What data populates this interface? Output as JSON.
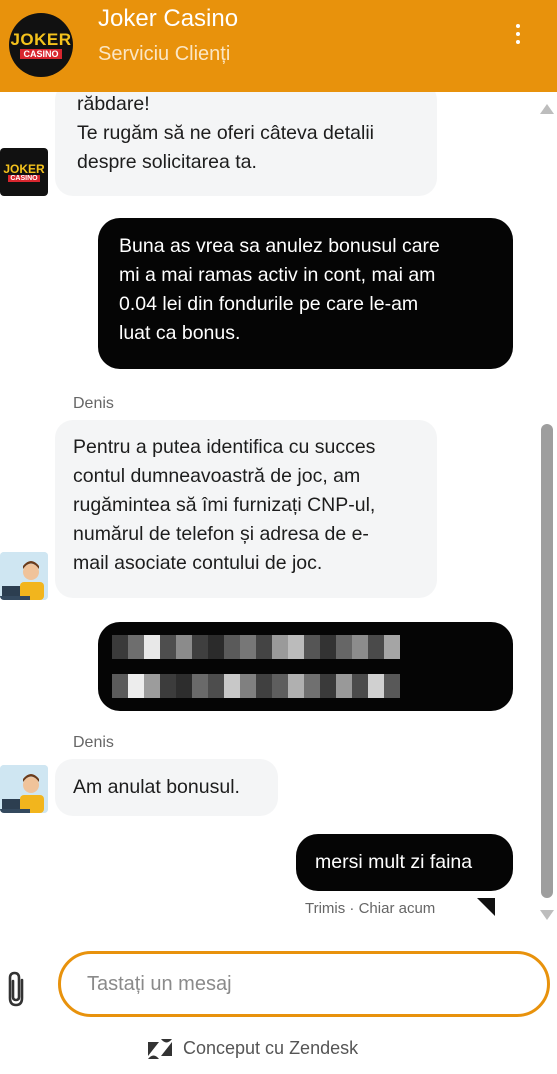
{
  "header": {
    "logo_line1": "JOKER",
    "logo_line2": "CASINO",
    "title": "Joker Casino",
    "subtitle": "Serviciu Clienți",
    "menu_icon": "more-vertical-icon"
  },
  "messages": [
    {
      "from": "bot",
      "lines": [
        "răbdare!",
        "Te rugăm să ne oferi câteva detalii",
        "despre solicitarea ta."
      ]
    },
    {
      "from": "user",
      "lines": [
        "Buna as vrea sa anulez bonusul care",
        "mi a mai ramas activ in cont, mai am",
        "0.04 lei din fondurile pe care le-am",
        "luat ca bonus."
      ]
    },
    {
      "from": "agent",
      "sender": "Denis",
      "lines": [
        "Pentru a putea identifica cu succes",
        "contul dumneavoastră de joc, am",
        "rugămintea să îmi furnizați CNP-ul,",
        "numărul de telefon și adresa de e-",
        "mail asociate contului de joc."
      ]
    },
    {
      "from": "user",
      "redacted": true
    },
    {
      "from": "agent",
      "sender": "Denis",
      "lines": [
        "Am anulat bonusul."
      ]
    },
    {
      "from": "user",
      "lines": [
        "mersi mult zi faina"
      ],
      "status": "Trimis · Chiar acum"
    }
  ],
  "composer": {
    "placeholder": "Tastați un mesaj",
    "attach_icon": "paperclip-icon"
  },
  "footer": {
    "powered_by": "Conceput cu Zendesk",
    "brand_icon": "zendesk-icon"
  },
  "colors": {
    "accent": "#e8920c",
    "user_bubble": "#050505",
    "agent_bubble": "#f4f5f6"
  }
}
